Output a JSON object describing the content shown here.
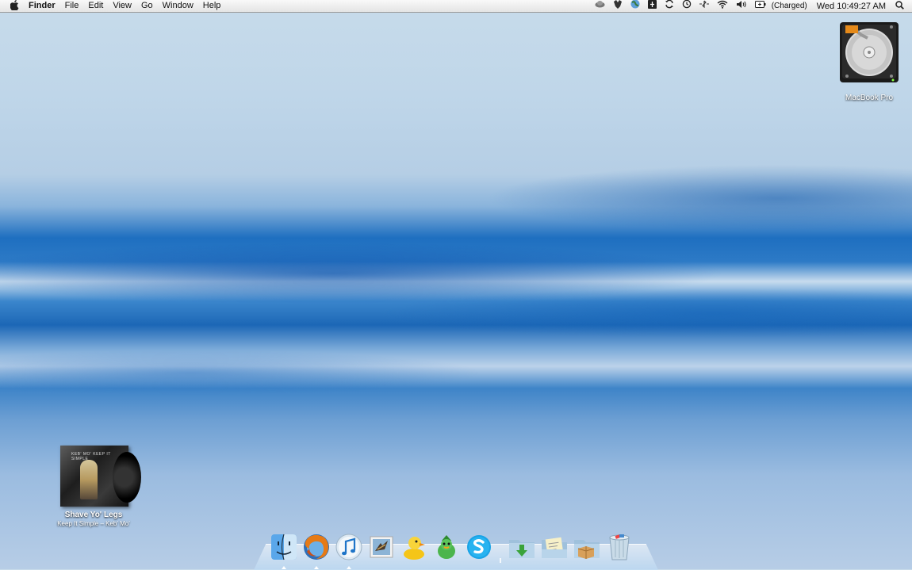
{
  "menubar": {
    "app_name": "Finder",
    "menus": [
      "File",
      "Edit",
      "View",
      "Go",
      "Window",
      "Help"
    ],
    "battery_status": "(Charged)",
    "clock": "Wed 10:49:27 AM"
  },
  "desktop": {
    "drive": {
      "label": "MacBook Pro"
    },
    "now_playing": {
      "title": "Shave Yo' Legs",
      "artist_line": "Keep It Simple – Keb' Mo'",
      "cover_text": "KEB' MO' KEEP IT SIMPLE"
    }
  },
  "dock": {
    "apps": [
      {
        "name": "finder",
        "running": true
      },
      {
        "name": "firefox",
        "running": true
      },
      {
        "name": "itunes",
        "running": true
      },
      {
        "name": "mail",
        "running": false
      },
      {
        "name": "cyberduck",
        "running": false
      },
      {
        "name": "adium",
        "running": false
      },
      {
        "name": "skype",
        "running": false
      }
    ],
    "stacks": [
      "downloads",
      "documents",
      "applications"
    ],
    "trash": "trash"
  }
}
